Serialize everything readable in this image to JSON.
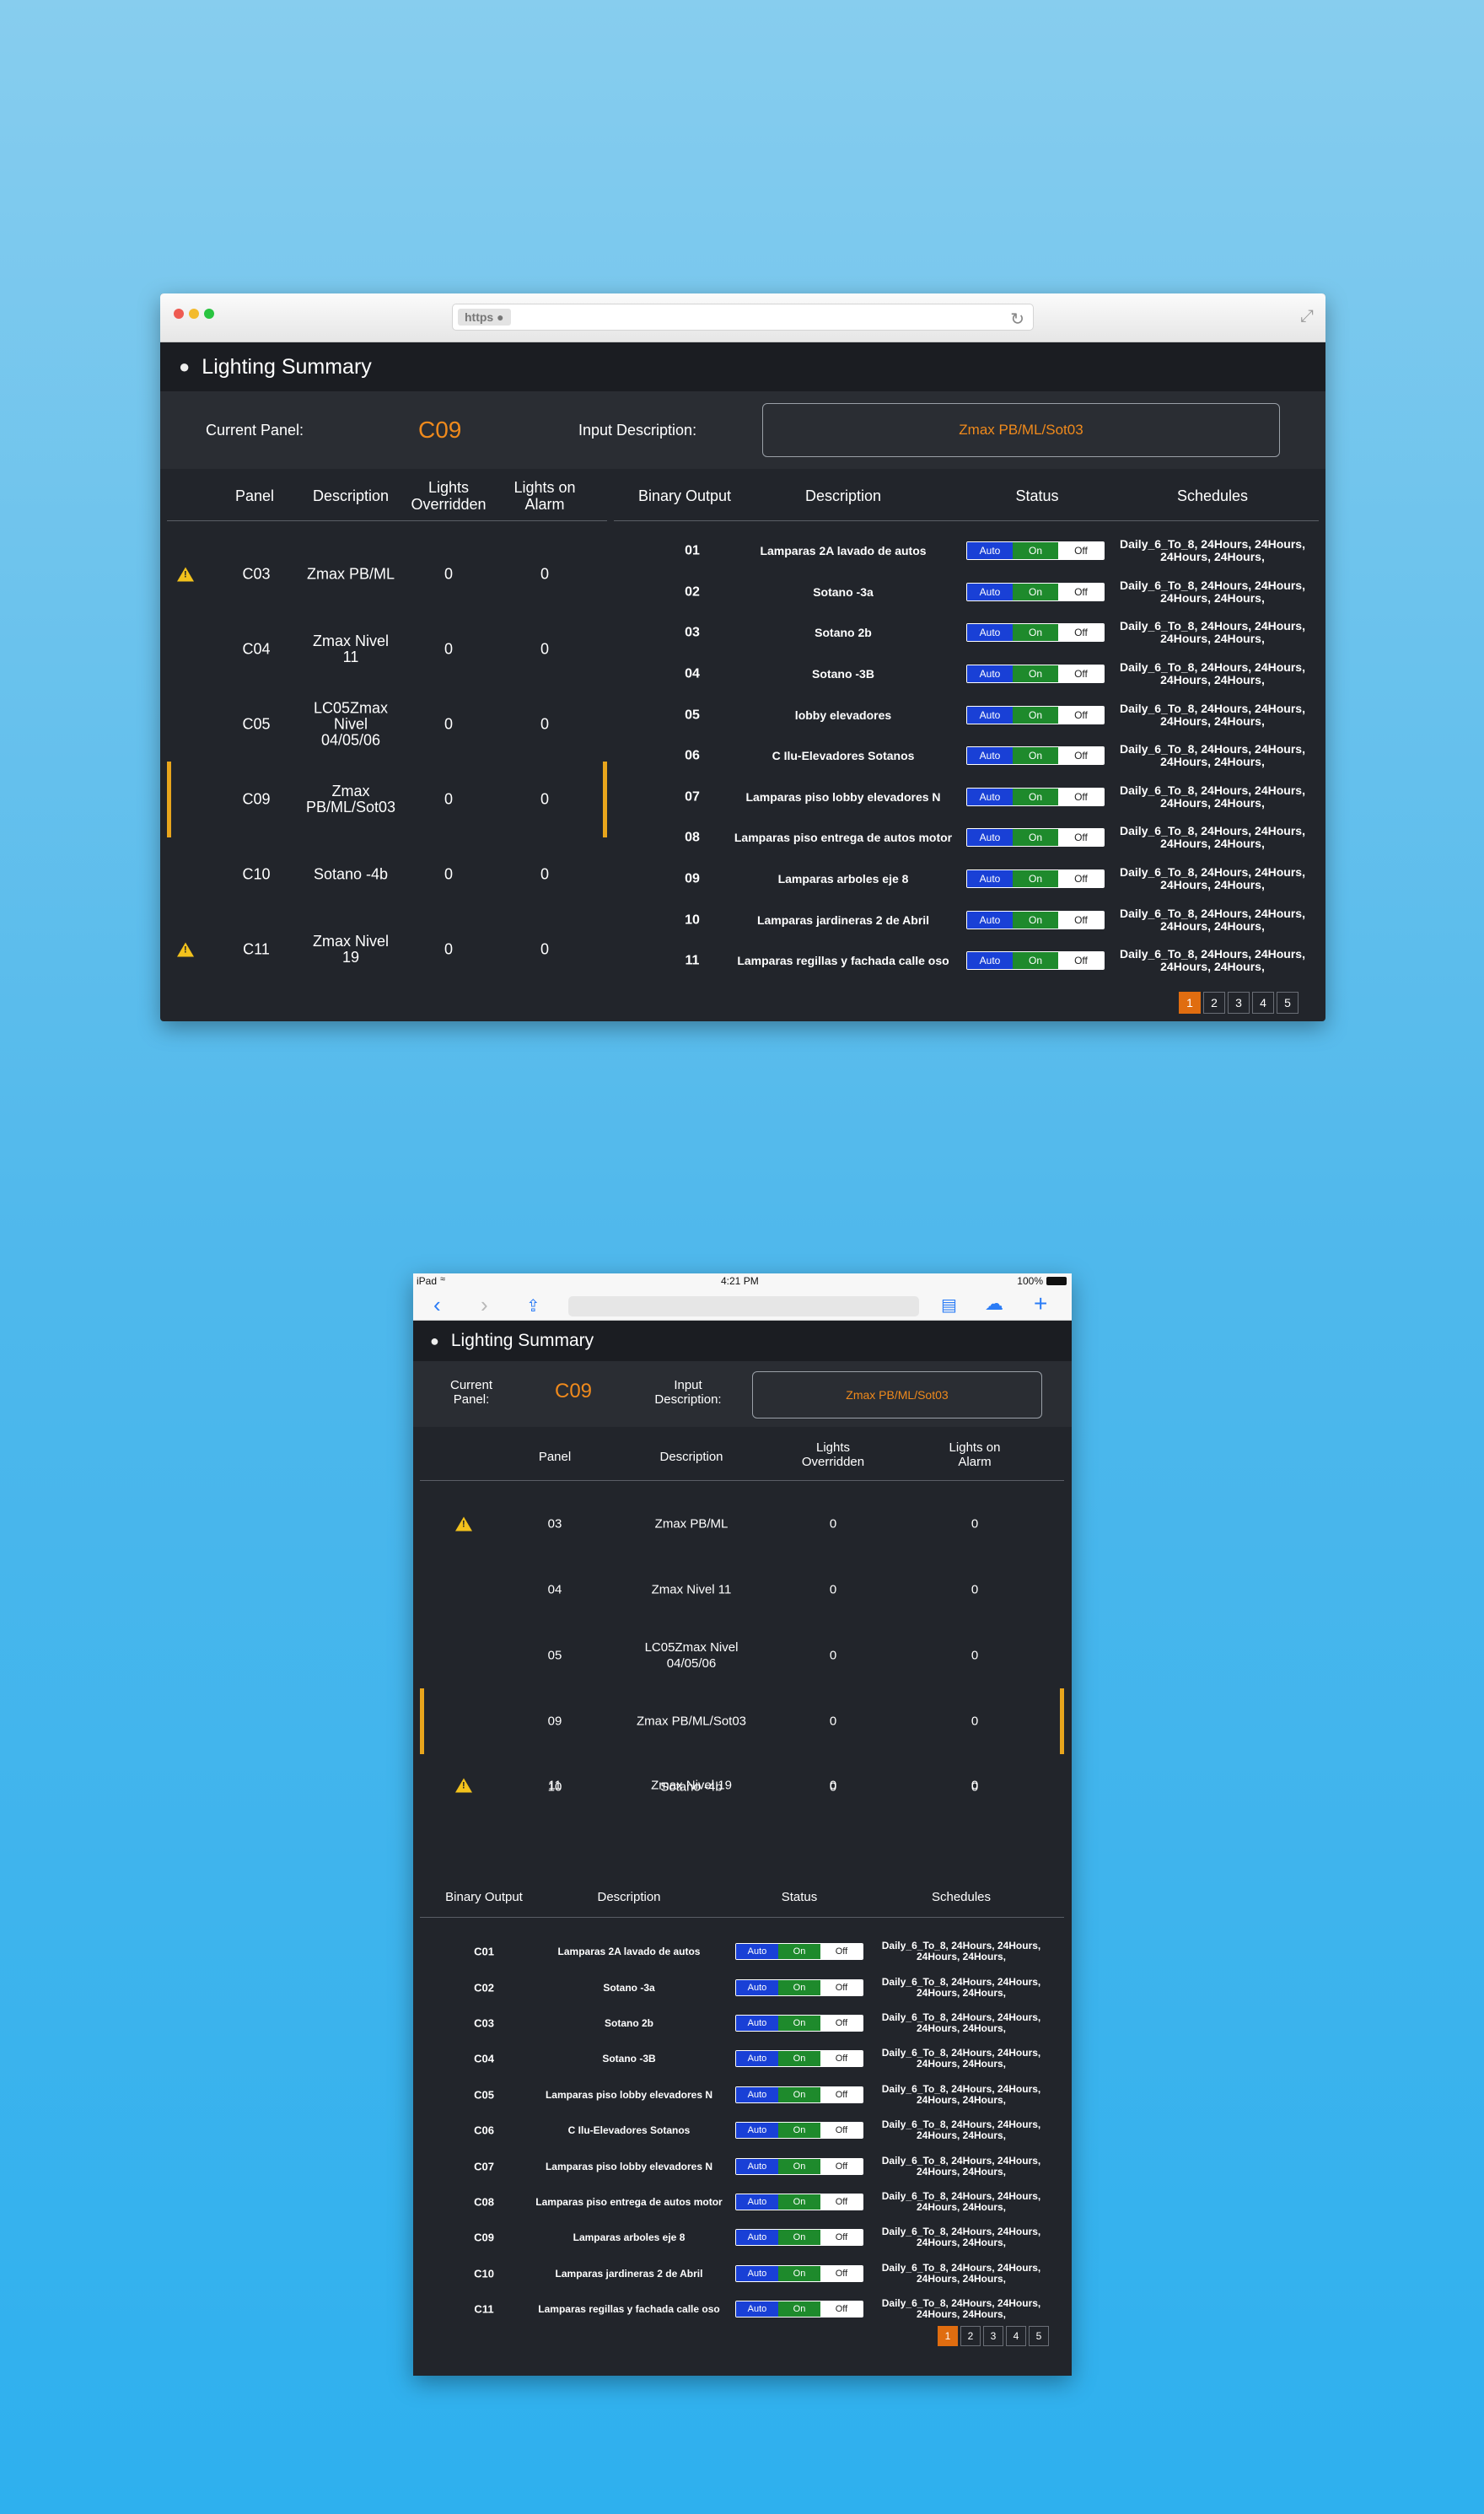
{
  "desktop": {
    "browser": {
      "protocol_badge": "https"
    },
    "app": {
      "title": "Lighting Summary"
    },
    "controls": {
      "current_panel_label": "Current Panel:",
      "current_panel_value": "C09",
      "input_description_label": "Input Description:",
      "input_description_value": "Zmax PB/ML/Sot03"
    },
    "panels": {
      "headers": {
        "panel": "Panel",
        "description": "Description",
        "lights_overridden": "Lights Overridden",
        "lights_on_alarm": "Lights on Alarm"
      },
      "rows": [
        {
          "warn": true,
          "panel": "C03",
          "description": "Zmax PB/ML",
          "overridden": "0",
          "alarm": "0",
          "selected": false
        },
        {
          "warn": false,
          "panel": "C04",
          "description": "Zmax Nivel 11",
          "overridden": "0",
          "alarm": "0",
          "selected": false
        },
        {
          "warn": false,
          "panel": "C05",
          "description": "LC05Zmax Nivel 04/05/06",
          "overridden": "0",
          "alarm": "0",
          "selected": false
        },
        {
          "warn": false,
          "panel": "C09",
          "description": "Zmax PB/ML/Sot03",
          "overridden": "0",
          "alarm": "0",
          "selected": true
        },
        {
          "warn": false,
          "panel": "C10",
          "description": "Sotano -4b",
          "overridden": "0",
          "alarm": "0",
          "selected": false
        },
        {
          "warn": true,
          "panel": "C11",
          "description": "Zmax Nivel 19",
          "overridden": "0",
          "alarm": "0",
          "selected": false
        }
      ]
    },
    "outputs": {
      "headers": {
        "binary_output": "Binary Output",
        "description": "Description",
        "status": "Status",
        "schedules": "Schedules"
      },
      "status_labels": {
        "auto": "Auto",
        "on": "On",
        "off": "Off"
      },
      "rows": [
        {
          "id": "01",
          "description": "Lamparas 2A lavado de autos",
          "schedule": "Daily_6_To_8, 24Hours, 24Hours, 24Hours, 24Hours,"
        },
        {
          "id": "02",
          "description": "Sotano -3a",
          "schedule": "Daily_6_To_8, 24Hours, 24Hours, 24Hours, 24Hours,"
        },
        {
          "id": "03",
          "description": "Sotano 2b",
          "schedule": "Daily_6_To_8, 24Hours, 24Hours, 24Hours, 24Hours,"
        },
        {
          "id": "04",
          "description": "Sotano -3B",
          "schedule": "Daily_6_To_8, 24Hours, 24Hours, 24Hours, 24Hours,"
        },
        {
          "id": "05",
          "description": "lobby elevadores",
          "schedule": "Daily_6_To_8, 24Hours, 24Hours, 24Hours, 24Hours,"
        },
        {
          "id": "06",
          "description": "C Ilu-Elevadores Sotanos",
          "schedule": "Daily_6_To_8, 24Hours, 24Hours, 24Hours, 24Hours,"
        },
        {
          "id": "07",
          "description": "Lamparas piso lobby elevadores N",
          "schedule": "Daily_6_To_8, 24Hours, 24Hours, 24Hours, 24Hours,"
        },
        {
          "id": "08",
          "description": "Lamparas piso entrega de autos motor",
          "schedule": "Daily_6_To_8, 24Hours, 24Hours, 24Hours, 24Hours,"
        },
        {
          "id": "09",
          "description": "Lamparas arboles eje 8",
          "schedule": "Daily_6_To_8, 24Hours, 24Hours, 24Hours, 24Hours,"
        },
        {
          "id": "10",
          "description": "Lamparas jardineras 2 de Abril",
          "schedule": "Daily_6_To_8, 24Hours, 24Hours, 24Hours, 24Hours,"
        },
        {
          "id": "11",
          "description": "Lamparas regillas y fachada calle oso",
          "schedule": "Daily_6_To_8, 24Hours, 24Hours, 24Hours, 24Hours,"
        }
      ]
    },
    "pagination": {
      "pages": [
        "1",
        "2",
        "3",
        "4",
        "5"
      ],
      "active": "1"
    }
  },
  "tablet": {
    "status_bar": {
      "device": "iPad",
      "time": "4:21 PM",
      "battery": "100%"
    },
    "app": {
      "title": "Lighting Summary"
    },
    "controls": {
      "current_panel_label": "Current Panel:",
      "current_panel_value": "C09",
      "input_description_label": "Input Description:",
      "input_description_value": "Zmax PB/ML/Sot03"
    },
    "panels": {
      "headers": {
        "panel": "Panel",
        "description": "Description",
        "lights_overridden": "Lights Overridden",
        "lights_on_alarm": "Lights on Alarm"
      },
      "rows": [
        {
          "warn": true,
          "panel": "03",
          "description": "Zmax PB/ML",
          "overridden": "0",
          "alarm": "0",
          "selected": false
        },
        {
          "warn": false,
          "panel": "04",
          "description": "Zmax Nivel 11",
          "overridden": "0",
          "alarm": "0",
          "selected": false
        },
        {
          "warn": false,
          "panel": "05",
          "description": "LC05Zmax Nivel 04/05/06",
          "overridden": "0",
          "alarm": "0",
          "selected": false
        },
        {
          "warn": false,
          "panel": "09",
          "description": "Zmax PB/ML/Sot03",
          "overridden": "0",
          "alarm": "0",
          "selected": true
        },
        {
          "warn": false,
          "panel": "10",
          "description": "Sotano -4b",
          "overridden": "0",
          "alarm": "0",
          "selected": false
        },
        {
          "warn": true,
          "panel": "11",
          "description": "Zmax Nivel 19",
          "overridden": "0",
          "alarm": "0",
          "selected": false
        }
      ]
    },
    "outputs": {
      "headers": {
        "binary_output": "Binary Output",
        "description": "Description",
        "status": "Status",
        "schedules": "Schedules"
      },
      "status_labels": {
        "auto": "Auto",
        "on": "On",
        "off": "Off"
      },
      "rows": [
        {
          "id": "C01",
          "description": "Lamparas 2A lavado de autos",
          "schedule": "Daily_6_To_8, 24Hours, 24Hours, 24Hours, 24Hours,"
        },
        {
          "id": "C02",
          "description": "Sotano -3a",
          "schedule": "Daily_6_To_8, 24Hours, 24Hours, 24Hours, 24Hours,"
        },
        {
          "id": "C03",
          "description": "Sotano 2b",
          "schedule": "Daily_6_To_8, 24Hours, 24Hours, 24Hours, 24Hours,"
        },
        {
          "id": "C04",
          "description": "Sotano -3B",
          "schedule": "Daily_6_To_8, 24Hours, 24Hours, 24Hours, 24Hours,"
        },
        {
          "id": "C05",
          "description": "Lamparas piso lobby elevadores N",
          "schedule": "Daily_6_To_8, 24Hours, 24Hours, 24Hours, 24Hours,"
        },
        {
          "id": "C06",
          "description": "C Ilu-Elevadores Sotanos",
          "schedule": "Daily_6_To_8, 24Hours, 24Hours, 24Hours, 24Hours,"
        },
        {
          "id": "C07",
          "description": "Lamparas piso lobby elevadores N",
          "schedule": "Daily_6_To_8, 24Hours, 24Hours, 24Hours, 24Hours,"
        },
        {
          "id": "C08",
          "description": "Lamparas piso entrega de autos motor",
          "schedule": "Daily_6_To_8, 24Hours, 24Hours, 24Hours, 24Hours,"
        },
        {
          "id": "C09",
          "description": "Lamparas arboles eje 8",
          "schedule": "Daily_6_To_8, 24Hours, 24Hours, 24Hours, 24Hours,"
        },
        {
          "id": "C10",
          "description": "Lamparas jardineras 2 de Abril",
          "schedule": "Daily_6_To_8, 24Hours, 24Hours, 24Hours, 24Hours,"
        },
        {
          "id": "C11",
          "description": "Lamparas regillas y fachada calle oso",
          "schedule": "Daily_6_To_8, 24Hours, 24Hours, 24Hours, 24Hours,"
        }
      ]
    },
    "pagination": {
      "pages": [
        "1",
        "2",
        "3",
        "4",
        "5"
      ],
      "active": "1"
    }
  },
  "colors": {
    "accent": "#f08a1c",
    "panel_bg": "#22252b",
    "auto": "#1940d6",
    "on": "#1e8a2c",
    "warning": "#f3c21c",
    "selection": "#e8a51c"
  }
}
